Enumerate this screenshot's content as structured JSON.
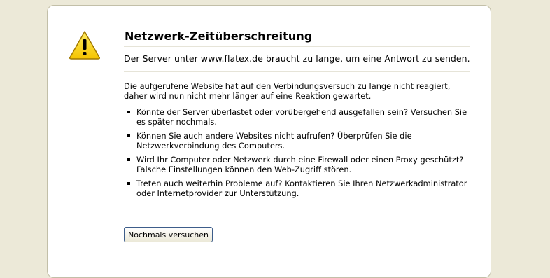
{
  "error": {
    "icon": "warning-icon",
    "title": "Netzwerk-Zeitüberschreitung",
    "short_desc": "Der Server unter www.flatex.de braucht zu lange, um eine Antwort zu senden.",
    "long_desc": "Die aufgerufene Website hat auf den Verbindungsversuch zu lange nicht reagiert, daher wird nun nicht mehr länger auf eine Reaktion gewartet.",
    "suggestions": [
      "Könnte der Server überlastet oder vorübergehend ausgefallen sein? Versuchen Sie es später nochmals.",
      "Können Sie auch andere Websites nicht aufrufen? Überprüfen Sie die Netzwerkverbindung des Computers.",
      "Wird Ihr Computer oder Netzwerk durch eine Firewall oder einen Proxy geschützt? Falsche Einstellungen können den Web-Zugriff stören.",
      "Treten auch weiterhin Probleme auf? Kontaktieren Sie Ihren Netzwerkadministrator oder Internetprovider zur Unterstützung."
    ],
    "retry_label": "Nochmals versuchen"
  },
  "colors": {
    "background": "#ece9d8",
    "card": "#ffffff",
    "icon_fill": "#ffd400"
  }
}
